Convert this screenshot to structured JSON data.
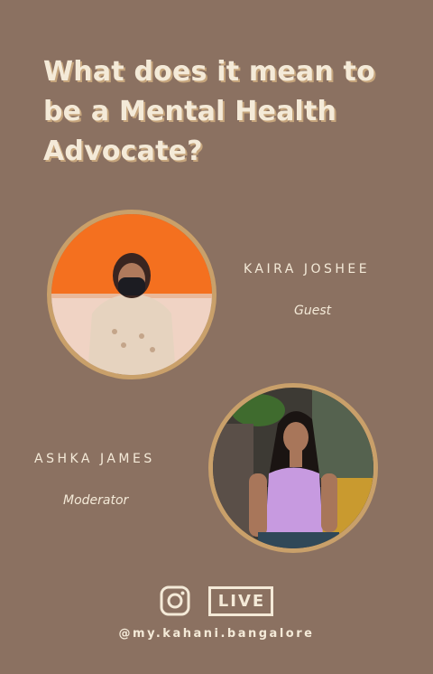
{
  "title": "What does it mean to be a Mental Health Advocate?",
  "guest": {
    "name": "KAIRA JOSHEE",
    "role": "Guest"
  },
  "moderator": {
    "name": "ASHKA JAMES",
    "role": "Moderator"
  },
  "footer": {
    "live_label": "LIVE",
    "handle": "@my.kahani.bangalore",
    "social_icon": "instagram-icon"
  },
  "colors": {
    "background": "#8b7161",
    "text": "#f4ead8",
    "accent": "#c9a06a"
  }
}
